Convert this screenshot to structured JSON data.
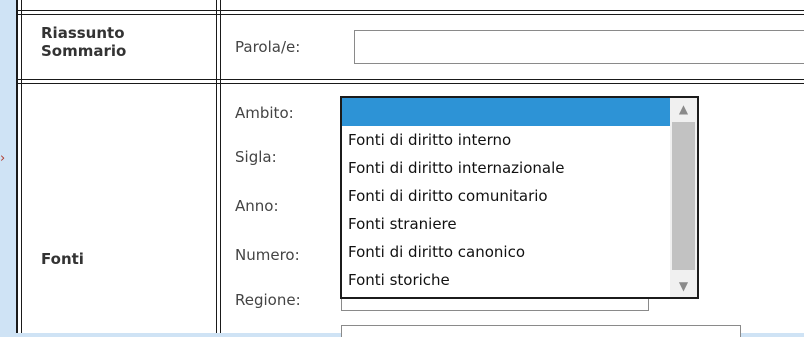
{
  "left_marker": "›",
  "rows": {
    "riassunto": {
      "label": "Riassunto Sommario",
      "line1": "Riassunto",
      "line2": "Sommario",
      "field_label": "Parola/e:",
      "input_value": ""
    },
    "fonti": {
      "label": "Fonti",
      "fields": {
        "ambito": "Ambito:",
        "sigla": "Sigla:",
        "anno": "Anno:",
        "numero": "Numero:",
        "regione": "Regione:"
      }
    }
  },
  "ambito_dropdown": {
    "selected_value": "",
    "options": [
      "Fonti di diritto interno",
      "Fonti di diritto internazionale",
      "Fonti di diritto comunitario",
      "Fonti straniere",
      "Fonti di diritto canonico",
      "Fonti storiche"
    ]
  },
  "icons": {
    "scroll_up": "▲",
    "scroll_down": "▼",
    "chevron": "⌄"
  },
  "colors": {
    "selection": "#2d93d6",
    "background": "#cfe3f5"
  }
}
